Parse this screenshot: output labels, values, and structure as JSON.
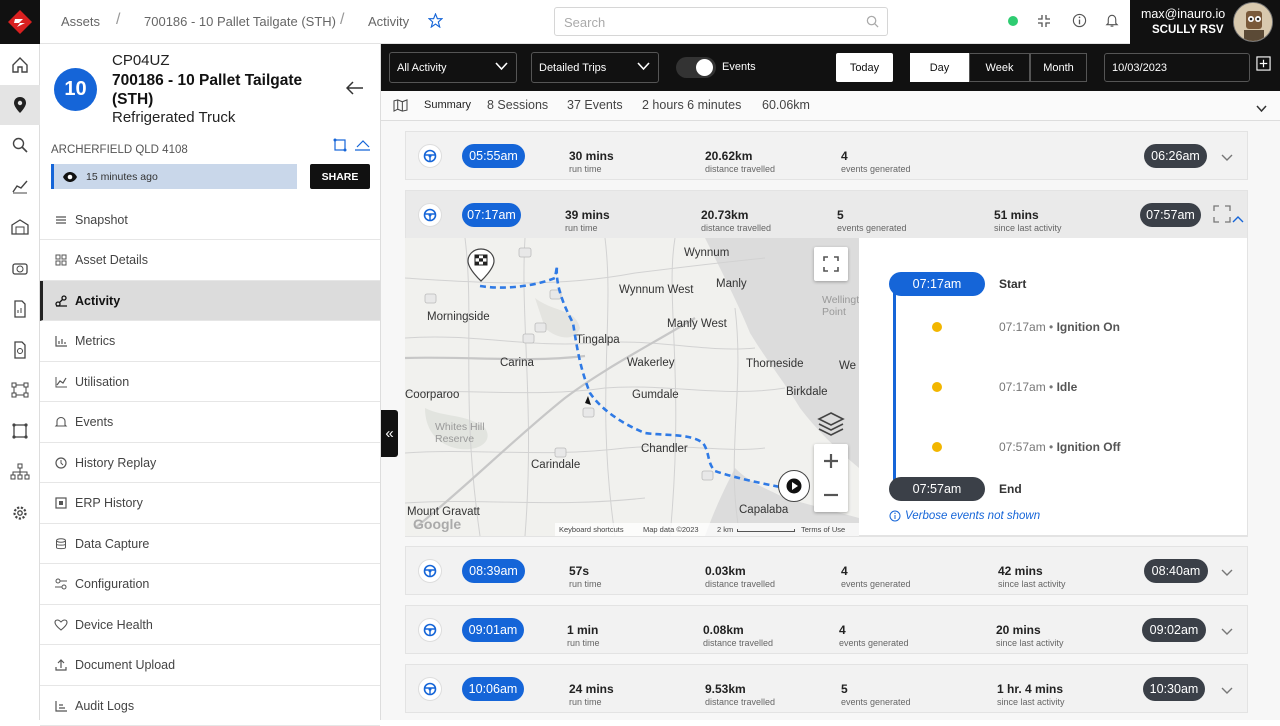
{
  "colors": {
    "accent": "#1565d8",
    "dark_pill": "#3b4048",
    "event_dot": "#f2b600",
    "brand_red": "#d92020"
  },
  "breadcrumb": {
    "assets": "Assets",
    "asset": "700186 - 10 Pallet Tailgate (STH)",
    "page": "Activity"
  },
  "search": {
    "placeholder": "Search"
  },
  "user": {
    "email": "max@inauro.io",
    "org": "SCULLY RSV"
  },
  "asset": {
    "badge": "10",
    "rego": "CP04UZ",
    "name": "700186 - 10 Pallet Tailgate (STH)",
    "type": "Refrigerated Truck",
    "location": "ARCHERFIELD QLD 4108",
    "last_seen": "15 minutes ago",
    "share_label": "SHARE"
  },
  "nav": [
    {
      "label": "Snapshot",
      "icon": "list-icon"
    },
    {
      "label": "Asset Details",
      "icon": "grid-icon"
    },
    {
      "label": "Activity",
      "icon": "activity-icon"
    },
    {
      "label": "Metrics",
      "icon": "metrics-icon"
    },
    {
      "label": "Utilisation",
      "icon": "utilisation-icon"
    },
    {
      "label": "Events",
      "icon": "bell-icon"
    },
    {
      "label": "History Replay",
      "icon": "history-icon"
    },
    {
      "label": "ERP History",
      "icon": "erp-icon"
    },
    {
      "label": "Data Capture",
      "icon": "database-icon"
    },
    {
      "label": "Configuration",
      "icon": "config-icon"
    },
    {
      "label": "Device Health",
      "icon": "health-icon"
    },
    {
      "label": "Document Upload",
      "icon": "upload-icon"
    },
    {
      "label": "Audit Logs",
      "icon": "audit-icon"
    }
  ],
  "controls": {
    "activity_filter": "All Activity",
    "trip_mode": "Detailed Trips",
    "events_toggle_label": "Events",
    "today": "Today",
    "ranges": [
      "Day",
      "Week",
      "Month"
    ],
    "selected_range": "Day",
    "date": "10/03/2023"
  },
  "summary": {
    "label": "Summary",
    "sessions": "8 Sessions",
    "events": "37 Events",
    "duration": "2 hours 6 minutes",
    "distance": "60.06km"
  },
  "trips": [
    {
      "start": "05:55am",
      "end": "06:26am",
      "runtime": "30 mins",
      "distance": "20.62km",
      "events": "4",
      "since": ""
    },
    {
      "start": "07:17am",
      "end": "07:57am",
      "runtime": "39 mins",
      "distance": "20.73km",
      "events": "5",
      "since": "51 mins"
    },
    {
      "start": "08:39am",
      "end": "08:40am",
      "runtime": "57s",
      "distance": "0.03km",
      "events": "4",
      "since": "42 mins"
    },
    {
      "start": "09:01am",
      "end": "09:02am",
      "runtime": "1 min",
      "distance": "0.08km",
      "events": "4",
      "since": "20 mins"
    },
    {
      "start": "10:06am",
      "end": "10:30am",
      "runtime": "24 mins",
      "distance": "9.53km",
      "events": "5",
      "since": "1 hr. 4 mins"
    }
  ],
  "stat_labels": {
    "runtime": "run time",
    "distance": "distance travelled",
    "events": "events generated",
    "since": "since last activity"
  },
  "timeline": {
    "start_time": "07:17am",
    "start_label": "Start",
    "end_time": "07:57am",
    "end_label": "End",
    "events": [
      {
        "time": "07:17am",
        "name": "Ignition On"
      },
      {
        "time": "07:17am",
        "name": "Idle"
      },
      {
        "time": "07:57am",
        "name": "Ignition Off"
      }
    ],
    "note": "Verbose events not shown"
  },
  "map": {
    "places": [
      "Wynnum",
      "Wynnum West",
      "Manly",
      "Manly West",
      "Morningside",
      "Tingalpa",
      "Carina",
      "Wakerley",
      "Thorneside",
      "Birkdale",
      "Gumdale",
      "Chandler",
      "Carindale",
      "Whites Hill Reserve",
      "Mount Gravatt",
      "Capalaba",
      "Wellington Point Recreation",
      "Coorparoo",
      "We"
    ],
    "footer": {
      "shortcuts": "Keyboard shortcuts",
      "mapdata": "Map data ©2023",
      "scale": "2 km",
      "terms": "Terms of Use"
    },
    "google": "Google"
  }
}
